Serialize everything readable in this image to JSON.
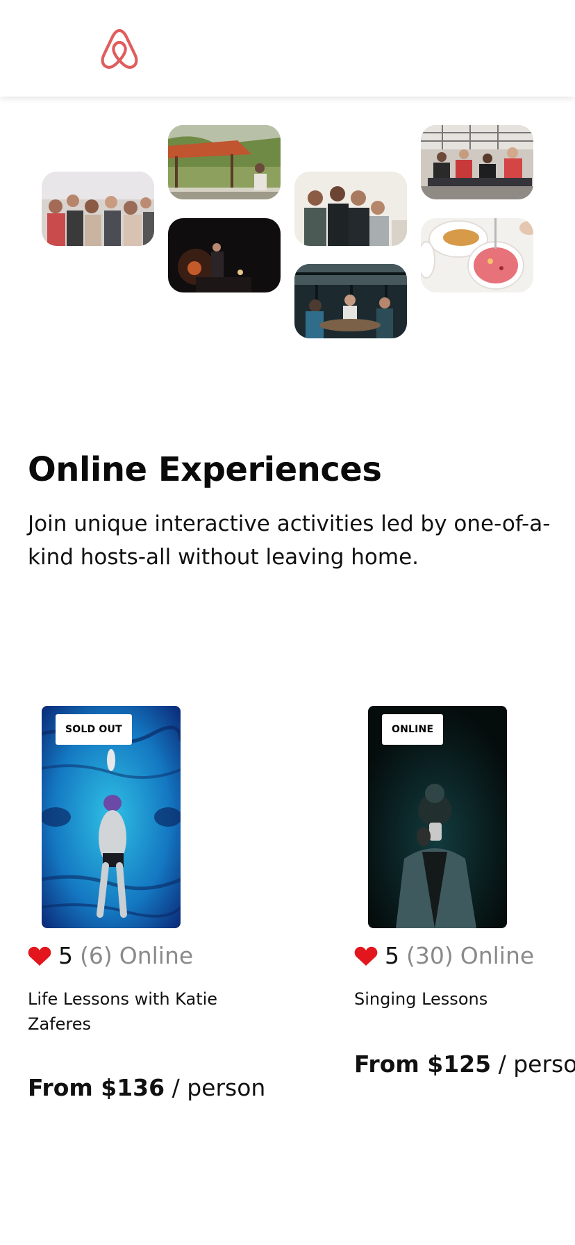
{
  "brand": {
    "logo_icon": "airbnb-logo-icon",
    "accent": "#E05D5D"
  },
  "photos": [
    {
      "name": "crowd-photo"
    },
    {
      "name": "gazebo-photo"
    },
    {
      "name": "dark-room-photo"
    },
    {
      "name": "friends-photo"
    },
    {
      "name": "cafe-photo"
    },
    {
      "name": "fitness-photo"
    },
    {
      "name": "food-photo"
    }
  ],
  "hero": {
    "title": "Online Experiences",
    "description": "Join unique interactive activities led by one-of-a-kind hosts-all without leaving home."
  },
  "cards": [
    {
      "badge": "SOLD OUT",
      "rating": "5",
      "review_count": "(6)",
      "location": "Online",
      "title": "Life Lessons with Katie Zaferes",
      "price_prefix": "From $136",
      "price_suffix": "/ person"
    },
    {
      "badge": "ONLINE",
      "rating": "5",
      "review_count": "(30)",
      "location": "Online",
      "title": "Singing Lessons",
      "price_prefix": "From $125",
      "price_suffix": "/ person"
    }
  ],
  "colors": {
    "heart": "#E3161E"
  }
}
